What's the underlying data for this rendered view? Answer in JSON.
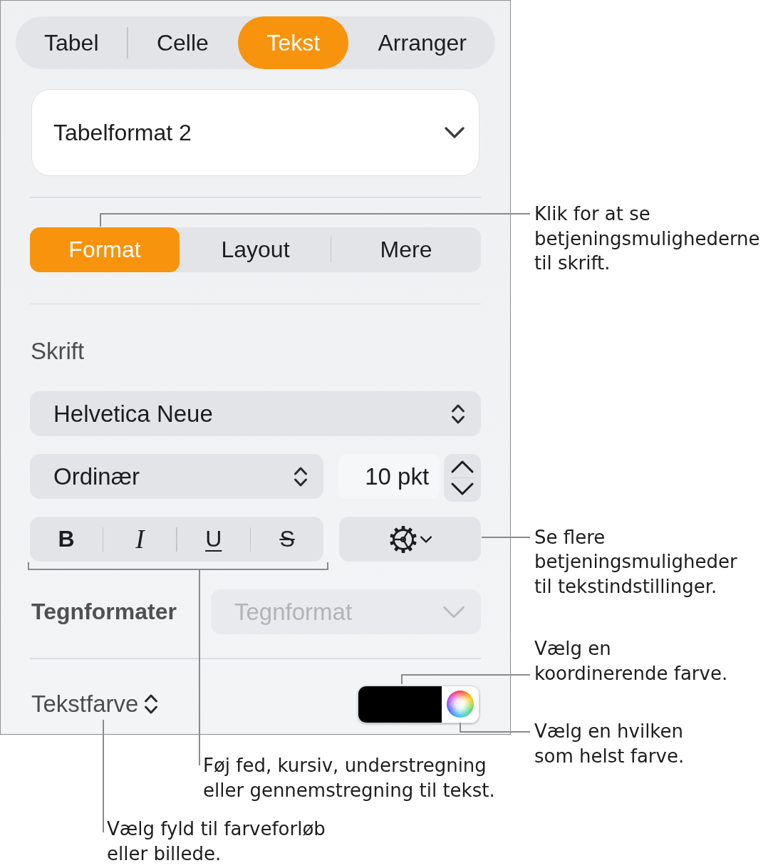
{
  "top_tabs": [
    {
      "label": "Tabel",
      "selected": false
    },
    {
      "label": "Celle",
      "selected": false
    },
    {
      "label": "Tekst",
      "selected": true
    },
    {
      "label": "Arranger",
      "selected": false
    }
  ],
  "style_menu": {
    "value": "Tabelformat 2"
  },
  "sub_tabs": [
    {
      "label": "Format",
      "selected": true
    },
    {
      "label": "Layout",
      "selected": false
    },
    {
      "label": "Mere",
      "selected": false
    }
  ],
  "font": {
    "title": "Skrift",
    "family": "Helvetica Neue",
    "typeface": "Ordinær",
    "size": "10 pkt",
    "style_buttons": [
      {
        "label": "B",
        "kind": "bold",
        "on": false
      },
      {
        "label": "I",
        "kind": "italic",
        "on": false
      },
      {
        "label": "U",
        "kind": "underline",
        "on": false
      },
      {
        "label": "S",
        "kind": "strikethrough",
        "on": false
      }
    ]
  },
  "character_styles": {
    "label": "Tegnformater",
    "value": "Tegnformat",
    "disabled": true
  },
  "text_color": {
    "label": "Tekstfarve",
    "color": "#000000"
  },
  "callouts_right": [
    {
      "lines": [
        "Klik for at se",
        "betjeningsmulighederne",
        "til skrift."
      ]
    },
    {
      "lines": [
        "Se flere",
        "betjeningsmuligheder",
        "til tekstindstillinger."
      ]
    },
    {
      "lines": [
        "Vælg en",
        "koordinerende farve."
      ]
    },
    {
      "lines": [
        "Vælg en hvilken",
        "som helst farve."
      ]
    }
  ],
  "callouts_below": [
    {
      "lines": [
        "Føj fed, kursiv, understregning",
        "eller gennemstregning til tekst."
      ]
    },
    {
      "lines": [
        "Vælg fyld til farveforløb",
        "eller billede."
      ]
    }
  ]
}
